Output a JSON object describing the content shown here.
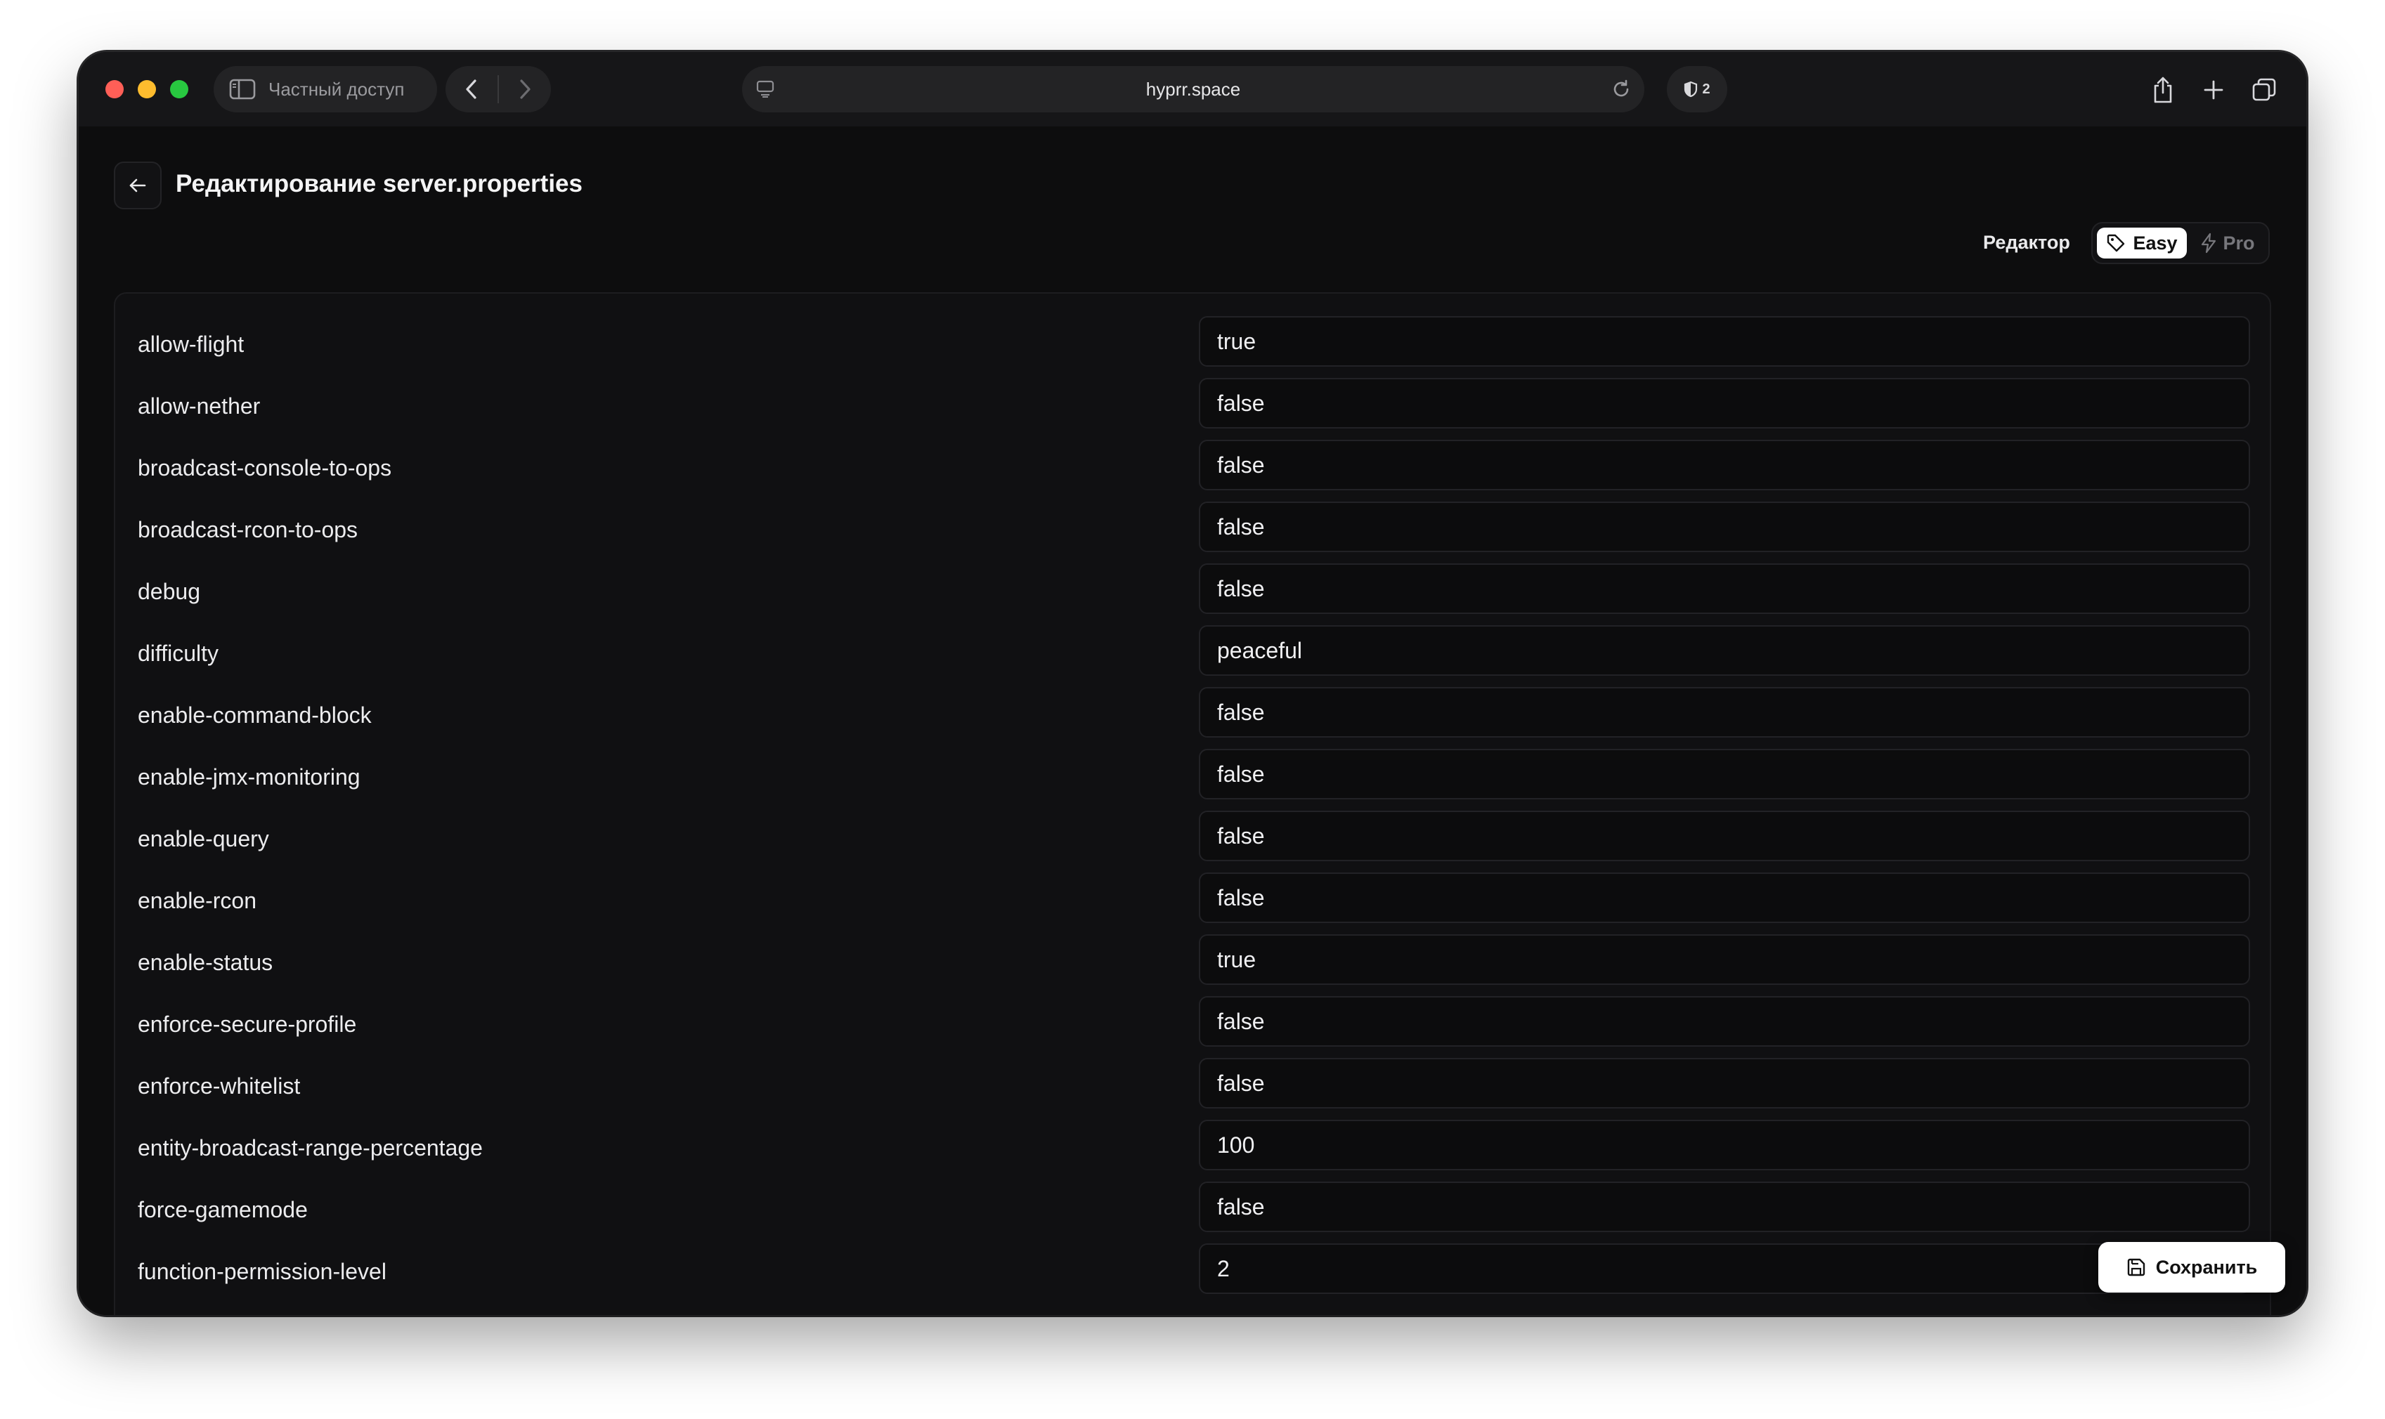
{
  "browser": {
    "private_label": "Частный доступ",
    "url": "hyprr.space",
    "shield_count": "2"
  },
  "page": {
    "title": "Редактирование server.properties",
    "editor_label": "Редактор",
    "mode_easy": "Easy",
    "mode_pro": "Pro",
    "save_label": "Сохранить"
  },
  "properties": [
    {
      "key": "allow-flight",
      "value": "true"
    },
    {
      "key": "allow-nether",
      "value": "false"
    },
    {
      "key": "broadcast-console-to-ops",
      "value": "false"
    },
    {
      "key": "broadcast-rcon-to-ops",
      "value": "false"
    },
    {
      "key": "debug",
      "value": "false"
    },
    {
      "key": "difficulty",
      "value": "peaceful"
    },
    {
      "key": "enable-command-block",
      "value": "false"
    },
    {
      "key": "enable-jmx-monitoring",
      "value": "false"
    },
    {
      "key": "enable-query",
      "value": "false"
    },
    {
      "key": "enable-rcon",
      "value": "false"
    },
    {
      "key": "enable-status",
      "value": "true"
    },
    {
      "key": "enforce-secure-profile",
      "value": "false"
    },
    {
      "key": "enforce-whitelist",
      "value": "false"
    },
    {
      "key": "entity-broadcast-range-percentage",
      "value": "100"
    },
    {
      "key": "force-gamemode",
      "value": "false"
    },
    {
      "key": "function-permission-level",
      "value": "2"
    }
  ],
  "colors": {
    "background": "#0d0d0e",
    "titlebar": "#161618",
    "accent_button": "#ffffff"
  }
}
